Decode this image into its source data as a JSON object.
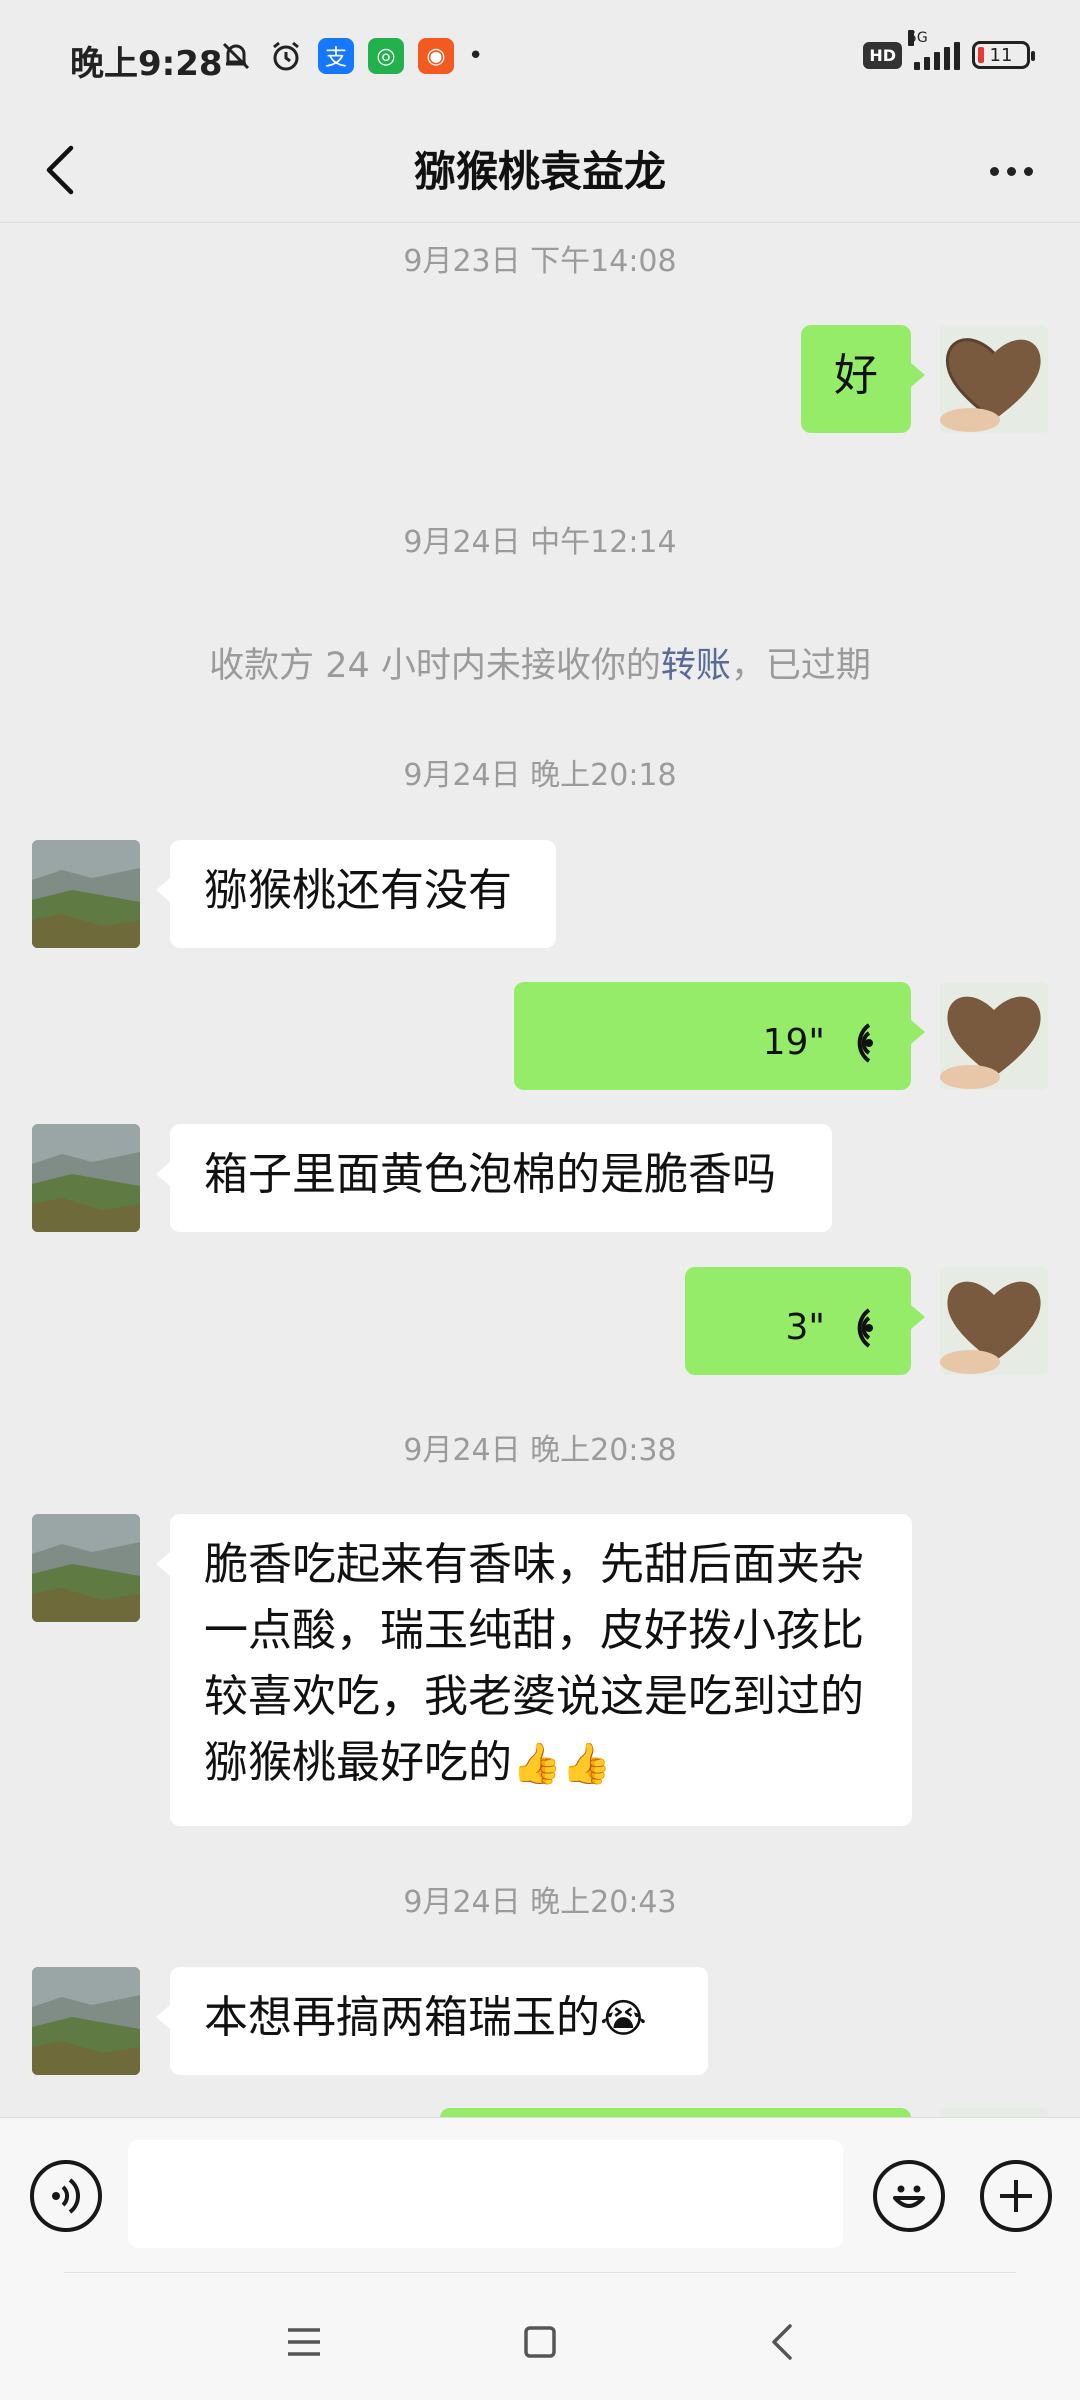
{
  "status_bar": {
    "time": "晚上9:28",
    "network": "5G",
    "hd": "HD",
    "battery": "11"
  },
  "header": {
    "title": "猕猴桃袁益龙"
  },
  "messages": {
    "ts1": "9月23日 下午14:08",
    "m1_text": "好",
    "ts2": "9月24日 中午12:14",
    "notice_pre": "收款方 24 小时内未接收你的",
    "notice_link": "转账",
    "notice_post": "，已过期",
    "ts3": "9月24日 晚上20:18",
    "m2_text": "猕猴桃还有没有",
    "m3_voice": "19\"",
    "m4_text": "箱子里面黄色泡棉的是脆香吗",
    "m5_voice": "3\"",
    "ts4": "9月24日 晚上20:38",
    "m6_line1": "脆香吃起来有香味，先甜后面夹杂",
    "m6_line2": "一点酸，瑞玉纯甜，皮好拨小孩比",
    "m6_line3": "较喜欢吃，我老婆说这是吃到过的",
    "m6_line4": "猕猴桃最好吃的",
    "m6_emoji": "👍👍",
    "ts5": "9月24日 晚上20:43",
    "m7_text": "本想再搞两箱瑞玉的",
    "m7_emoji": "😭"
  },
  "input": {
    "placeholder": ""
  },
  "colors": {
    "background": "#ededed",
    "bubble_self": "#95ec69",
    "bubble_other": "#ffffff",
    "link": "#576b95",
    "timestamp": "#9b9b9b"
  },
  "icons": {
    "back": "chevron-left-icon",
    "more": "more-dots-icon",
    "voice": "voice-wave-icon",
    "emoji": "smiley-icon",
    "add": "plus-icon"
  }
}
